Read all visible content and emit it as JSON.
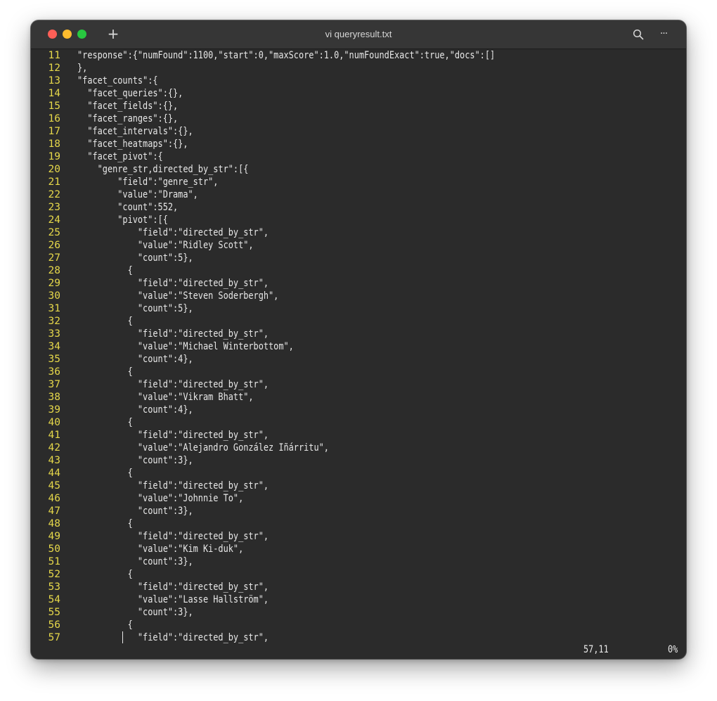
{
  "window": {
    "title": "vi queryresult.txt",
    "new_tab_label": "+",
    "more_label": "···"
  },
  "icons": {
    "new_tab": "plus-icon",
    "search": "search-icon",
    "more": "ellipsis-icon"
  },
  "colors": {
    "background": "#2b2b2b",
    "titlebar": "#363636",
    "line_numbers": "#e6d84a",
    "text": "#e8e8e8",
    "traffic_red": "#fe5f57",
    "traffic_yellow": "#febc2e",
    "traffic_green": "#28c840"
  },
  "editor": {
    "lines": [
      {
        "num": "11",
        "text": "\"response\":{\"numFound\":1100,\"start\":0,\"maxScore\":1.0,\"numFoundExact\":true,\"docs\":[]"
      },
      {
        "num": "12",
        "text": "},"
      },
      {
        "num": "13",
        "text": "\"facet_counts\":{"
      },
      {
        "num": "14",
        "text": "  \"facet_queries\":{},"
      },
      {
        "num": "15",
        "text": "  \"facet_fields\":{},"
      },
      {
        "num": "16",
        "text": "  \"facet_ranges\":{},"
      },
      {
        "num": "17",
        "text": "  \"facet_intervals\":{},"
      },
      {
        "num": "18",
        "text": "  \"facet_heatmaps\":{},"
      },
      {
        "num": "19",
        "text": "  \"facet_pivot\":{"
      },
      {
        "num": "20",
        "text": "    \"genre_str,directed_by_str\":[{"
      },
      {
        "num": "21",
        "text": "        \"field\":\"genre_str\","
      },
      {
        "num": "22",
        "text": "        \"value\":\"Drama\","
      },
      {
        "num": "23",
        "text": "        \"count\":552,"
      },
      {
        "num": "24",
        "text": "        \"pivot\":[{"
      },
      {
        "num": "25",
        "text": "            \"field\":\"directed_by_str\","
      },
      {
        "num": "26",
        "text": "            \"value\":\"Ridley Scott\","
      },
      {
        "num": "27",
        "text": "            \"count\":5},"
      },
      {
        "num": "28",
        "text": "          {"
      },
      {
        "num": "29",
        "text": "            \"field\":\"directed_by_str\","
      },
      {
        "num": "30",
        "text": "            \"value\":\"Steven Soderbergh\","
      },
      {
        "num": "31",
        "text": "            \"count\":5},"
      },
      {
        "num": "32",
        "text": "          {"
      },
      {
        "num": "33",
        "text": "            \"field\":\"directed_by_str\","
      },
      {
        "num": "34",
        "text": "            \"value\":\"Michael Winterbottom\","
      },
      {
        "num": "35",
        "text": "            \"count\":4},"
      },
      {
        "num": "36",
        "text": "          {"
      },
      {
        "num": "37",
        "text": "            \"field\":\"directed_by_str\","
      },
      {
        "num": "38",
        "text": "            \"value\":\"Vikram Bhatt\","
      },
      {
        "num": "39",
        "text": "            \"count\":4},"
      },
      {
        "num": "40",
        "text": "          {"
      },
      {
        "num": "41",
        "text": "            \"field\":\"directed_by_str\","
      },
      {
        "num": "42",
        "text": "            \"value\":\"Alejandro González Iñárritu\","
      },
      {
        "num": "43",
        "text": "            \"count\":3},"
      },
      {
        "num": "44",
        "text": "          {"
      },
      {
        "num": "45",
        "text": "            \"field\":\"directed_by_str\","
      },
      {
        "num": "46",
        "text": "            \"value\":\"Johnnie To\","
      },
      {
        "num": "47",
        "text": "            \"count\":3},"
      },
      {
        "num": "48",
        "text": "          {"
      },
      {
        "num": "49",
        "text": "            \"field\":\"directed_by_str\","
      },
      {
        "num": "50",
        "text": "            \"value\":\"Kim Ki-duk\","
      },
      {
        "num": "51",
        "text": "            \"count\":3},"
      },
      {
        "num": "52",
        "text": "          {"
      },
      {
        "num": "53",
        "text": "            \"field\":\"directed_by_str\","
      },
      {
        "num": "54",
        "text": "            \"value\":\"Lasse Hallström\","
      },
      {
        "num": "55",
        "text": "            \"count\":3},"
      },
      {
        "num": "56",
        "text": "          {"
      },
      {
        "num": "57",
        "text": "            \"field\":\"directed_by_str\","
      }
    ]
  },
  "status": {
    "cursor_position": "57,11",
    "scroll_percent": "0%"
  }
}
